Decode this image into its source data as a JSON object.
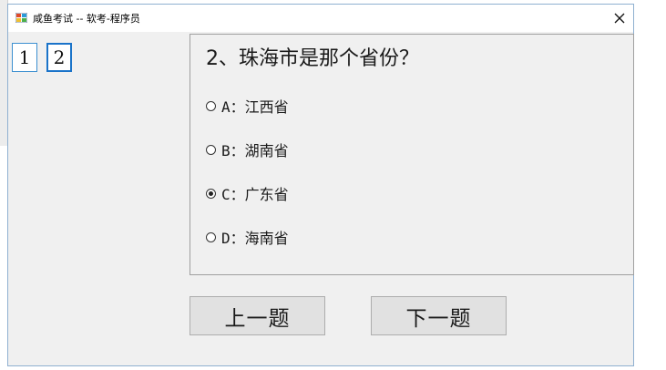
{
  "window": {
    "title": "咸鱼考试 -- 软考-程序员",
    "close_symbol": "✕"
  },
  "question_nav": [
    {
      "label": "1",
      "active": false
    },
    {
      "label": "2",
      "active": true
    }
  ],
  "question": {
    "text": "2、珠海市是那个省份？",
    "options": [
      {
        "label": "A：江西省",
        "selected": false
      },
      {
        "label": "B：湖南省",
        "selected": false
      },
      {
        "label": "C：广东省",
        "selected": true
      },
      {
        "label": "D：海南省",
        "selected": false
      }
    ]
  },
  "buttons": {
    "prev_label": "上一题",
    "next_label": "下一题"
  },
  "colors": {
    "accent": "#1a73c9",
    "window_bg": "#f0f0f0",
    "button_bg": "#e1e1e1"
  }
}
